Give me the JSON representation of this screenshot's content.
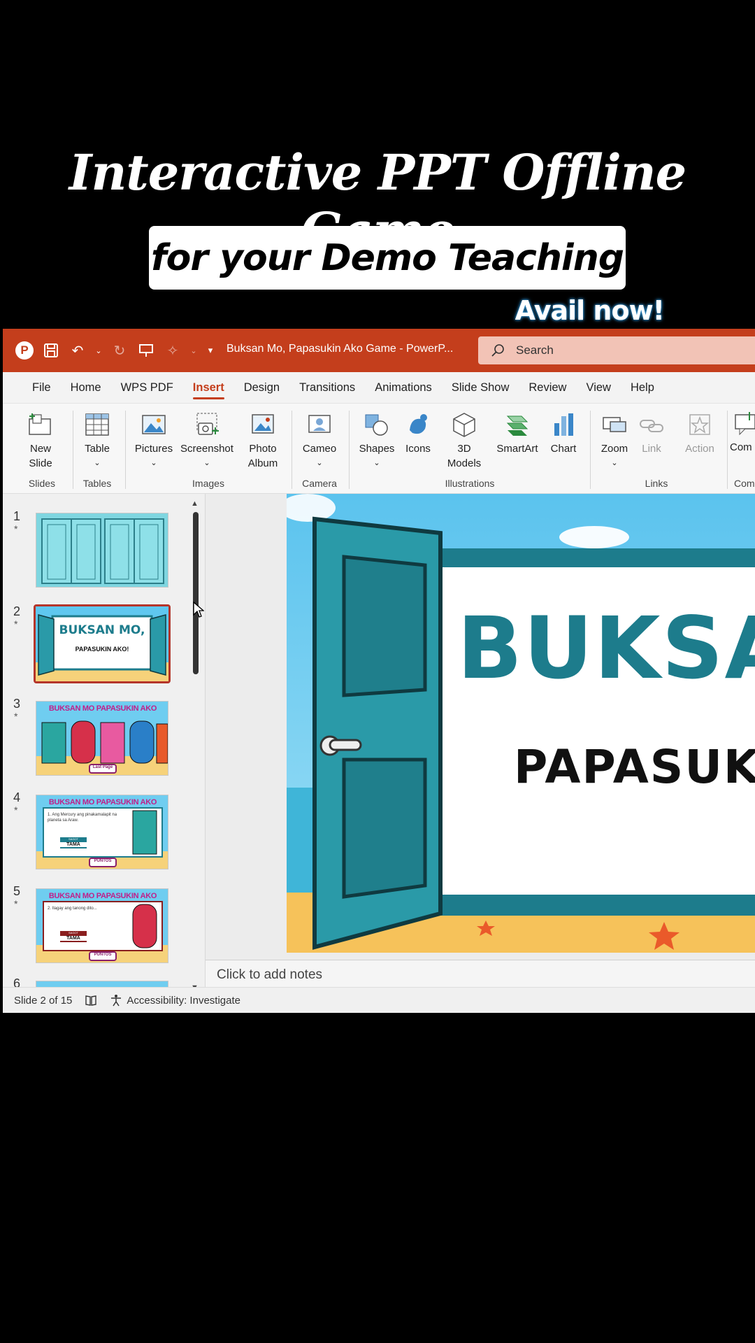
{
  "overlay": {
    "title": "Interactive PPT Offline Game",
    "subtitle": "for your Demo Teaching",
    "cta": "Avail now!"
  },
  "window": {
    "doc_title": "Buksan Mo, Papasukin Ako Game  -  PowerP...",
    "search_placeholder": "Search",
    "accent_color": "#c43e1c"
  },
  "menu": {
    "tabs": [
      "File",
      "Home",
      "WPS PDF",
      "Insert",
      "Design",
      "Transitions",
      "Animations",
      "Slide Show",
      "Review",
      "View",
      "Help"
    ],
    "active": "Insert"
  },
  "ribbon": {
    "buttons": {
      "new_slide": "New Slide",
      "table": "Table",
      "pictures": "Pictures",
      "screenshot": "Screenshot",
      "photo_album": "Photo Album",
      "cameo": "Cameo",
      "shapes": "Shapes",
      "icons": "Icons",
      "models_3d": "3D Models",
      "smartart": "SmartArt",
      "chart": "Chart",
      "zoom": "Zoom",
      "link": "Link",
      "action": "Action",
      "comment": "Com"
    },
    "groups": {
      "slides": "Slides",
      "tables": "Tables",
      "images": "Images",
      "camera": "Camera",
      "illustrations": "Illustrations",
      "links": "Links",
      "comments": "Com"
    }
  },
  "thumbnails": {
    "numbers": [
      "1",
      "2",
      "3",
      "4",
      "5",
      "6"
    ],
    "star": "*",
    "slide2_title": "BUKSAN MO,",
    "slide2_sub": "PAPASUKIN AKO!",
    "game_header": "BUKSAN MO PAPASUKIN AKO",
    "last_page": "Last Page",
    "q4": "1. Ang Mercury ang pinakamalapit na planeta sa Araw.",
    "q5": "2. Ilagay ang tanong dito...",
    "answer": "TAMA",
    "sagot": "SAGOT",
    "points": "PUNTOS"
  },
  "slide": {
    "title_fragment": "BUKSA",
    "subtitle_fragment": "PAPASUKI"
  },
  "notes": {
    "placeholder": "Click to add notes"
  },
  "status": {
    "slide_info": "Slide 2 of 15",
    "accessibility": "Accessibility: Investigate"
  }
}
